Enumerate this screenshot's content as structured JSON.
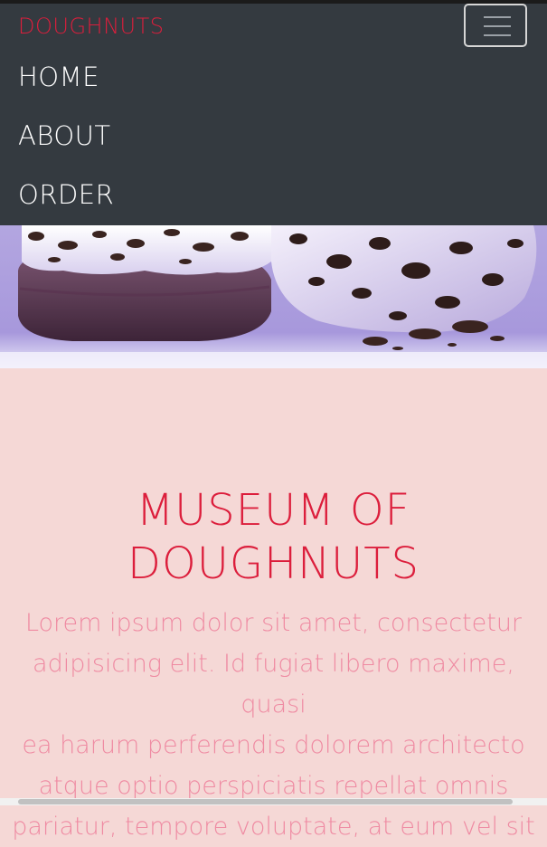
{
  "navbar": {
    "brand": "DOUGHNUTS",
    "toggler_icon": "hamburger-menu-icon",
    "items": [
      {
        "label": "HOME"
      },
      {
        "label": "ABOUT"
      },
      {
        "label": "ORDER"
      }
    ]
  },
  "hero": {
    "image_subject": "two chocolate doughnuts with white frosting and cookie crumbles on lavender background"
  },
  "main": {
    "title_line1": "MUSEUM OF",
    "title_line2": "DOUGHNUTS",
    "lead_lines": [
      "Lorem ipsum dolor sit amet, consectetur",
      "adipisicing elit. Id fugiat libero maxime, quasi",
      "ea harum perferendis dolorem architecto",
      "atque optio perspiciatis repellat omnis",
      "pariatur, tempore voluptate, at eum vel sit"
    ]
  },
  "colors": {
    "navbar_bg": "#343a40",
    "brand": "#dc1e3c",
    "content_bg": "#f5d8d6",
    "title": "#dc1e3c",
    "lead": "#ef8aa2"
  }
}
